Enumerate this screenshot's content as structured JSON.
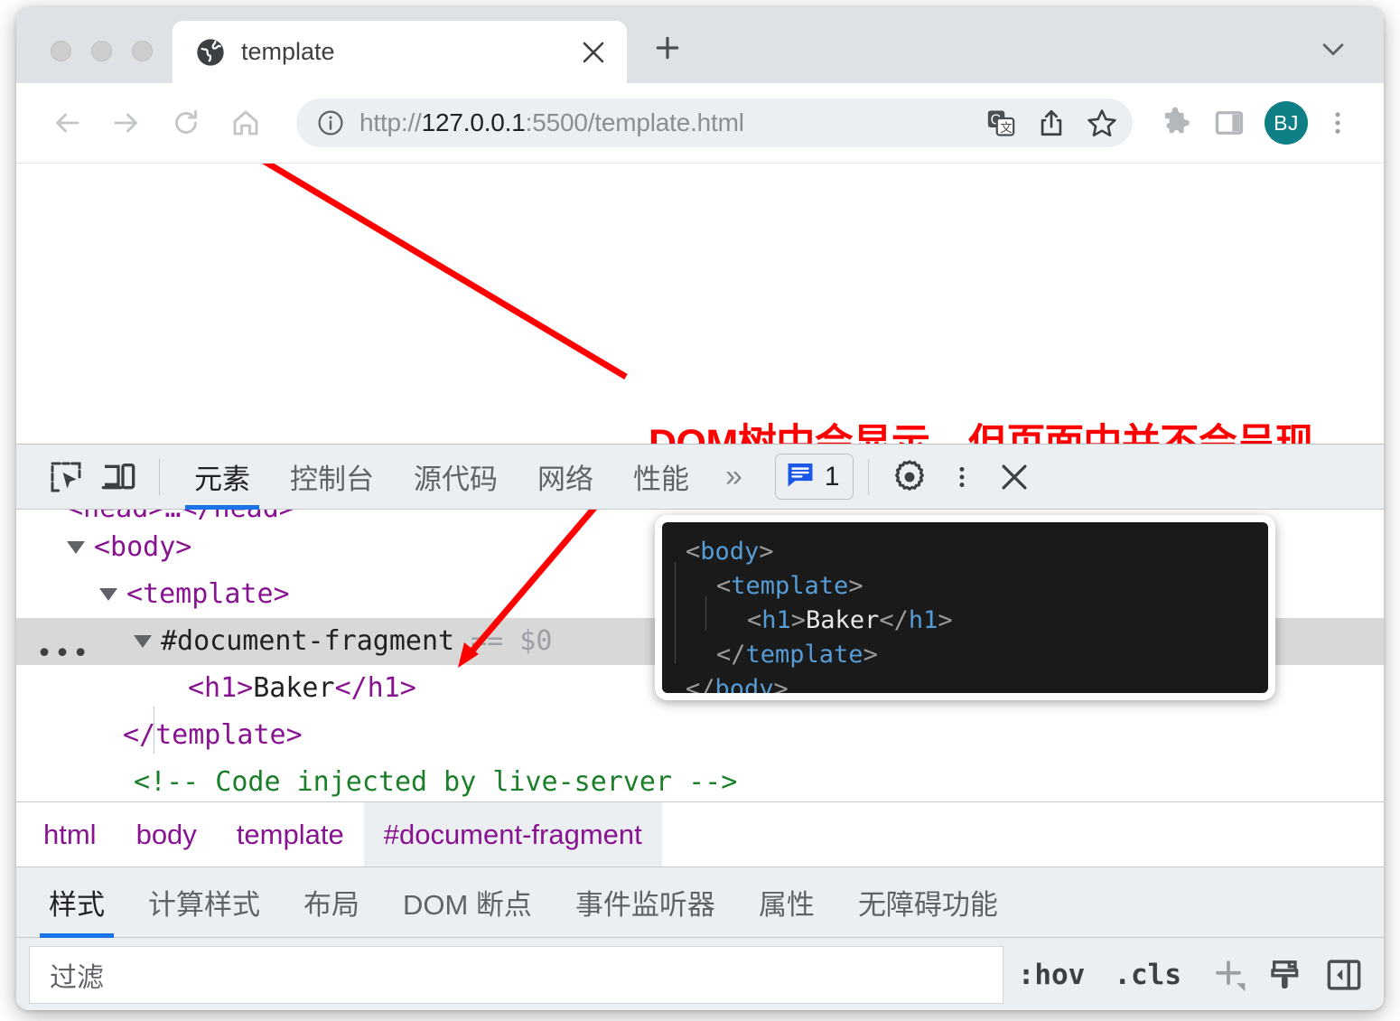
{
  "browser": {
    "tab": {
      "title": "template",
      "favicon_icon": "globe-icon",
      "close_icon": "close-icon"
    },
    "new_tab_icon": "plus-icon",
    "tabstrip_chevron_icon": "chevron-down-icon",
    "nav": {
      "back_icon": "arrow-left-icon",
      "forward_icon": "arrow-right-icon",
      "reload_icon": "reload-icon",
      "home_icon": "home-icon"
    },
    "omnibox": {
      "info_icon": "info-circle-icon",
      "url": "http://127.0.0.1:5500/template.html",
      "url_scheme": "http://",
      "url_host": "127.0.0.1",
      "url_rest": ":5500/template.html",
      "translate_icon": "translate-icon",
      "share_icon": "share-icon",
      "bookmark_icon": "star-icon"
    },
    "extensions_icon": "puzzle-icon",
    "side_panel_icon": "side-panel-icon",
    "avatar_initials": "BJ",
    "avatar_color": "#0e8085",
    "menu_icon": "three-dots-vertical-icon"
  },
  "page": {
    "annotation": "DOM树中会显示，但页面中并不会呈现",
    "annotation_color": "#ff0000"
  },
  "devtools": {
    "inspect_icon": "inspect-element-icon",
    "device_icon": "device-toolbar-icon",
    "tabs": [
      {
        "label": "元素",
        "selected": true
      },
      {
        "label": "控制台",
        "selected": false
      },
      {
        "label": "源代码",
        "selected": false
      },
      {
        "label": "网络",
        "selected": false
      },
      {
        "label": "性能",
        "selected": false
      }
    ],
    "overflow_label": "»",
    "message_badge": {
      "icon": "message-icon",
      "count": "1",
      "color": "#1a56e8"
    },
    "settings_icon": "gear-icon",
    "more_icon": "three-dots-vertical-icon",
    "close_icon": "close-icon",
    "dom_tree": [
      {
        "indent": 0,
        "kind": "cutoff",
        "text": "<head>…</head>"
      },
      {
        "indent": 0,
        "kind": "tag",
        "text": "<body>",
        "expanded": true
      },
      {
        "indent": 1,
        "kind": "tag",
        "text": "<template>",
        "expanded": true
      },
      {
        "indent": 2,
        "kind": "fragment",
        "text": "#document-fragment",
        "suffix": "== $0",
        "expanded": true,
        "selected": true
      },
      {
        "indent": 3,
        "kind": "element",
        "open": "<h1>",
        "text": "Baker",
        "close": "</h1>"
      },
      {
        "indent": 1,
        "kind": "tag",
        "text": "</template>"
      },
      {
        "indent": 1,
        "kind": "comment",
        "text": "<!-- Code injected by live-server -->"
      }
    ],
    "tooltip": {
      "lines": [
        {
          "indent": 0,
          "parts": [
            {
              "t": "<body>",
              "c": "tag"
            }
          ]
        },
        {
          "indent": 1,
          "parts": [
            {
              "t": "<template>",
              "c": "tag"
            }
          ]
        },
        {
          "indent": 2,
          "parts": [
            {
              "t": "<h1>",
              "c": "tag"
            },
            {
              "t": "Baker",
              "c": "text"
            },
            {
              "t": "</h1>",
              "c": "tag"
            }
          ]
        },
        {
          "indent": 1,
          "parts": [
            {
              "t": "</template>",
              "c": "tag"
            }
          ]
        },
        {
          "indent": 0,
          "parts": [
            {
              "t": "</body>",
              "c": "tag"
            }
          ]
        }
      ]
    },
    "breadcrumbs": [
      {
        "label": "html",
        "selected": false
      },
      {
        "label": "body",
        "selected": false
      },
      {
        "label": "template",
        "selected": false
      },
      {
        "label": "#document-fragment",
        "selected": true
      }
    ],
    "style_tabs": [
      {
        "label": "样式",
        "selected": true
      },
      {
        "label": "计算样式",
        "selected": false
      },
      {
        "label": "布局",
        "selected": false
      },
      {
        "label": "DOM 断点",
        "selected": false
      },
      {
        "label": "事件监听器",
        "selected": false
      },
      {
        "label": "属性",
        "selected": false
      },
      {
        "label": "无障碍功能",
        "selected": false
      }
    ],
    "filter": {
      "placeholder": "过滤",
      "value": "",
      "hov_label": ":hov",
      "cls_label": ".cls",
      "new_rule_icon": "plus-icon",
      "computed_icon": "paint-brush-icon",
      "sidebar_toggle_icon": "sidebar-toggle-icon"
    }
  }
}
